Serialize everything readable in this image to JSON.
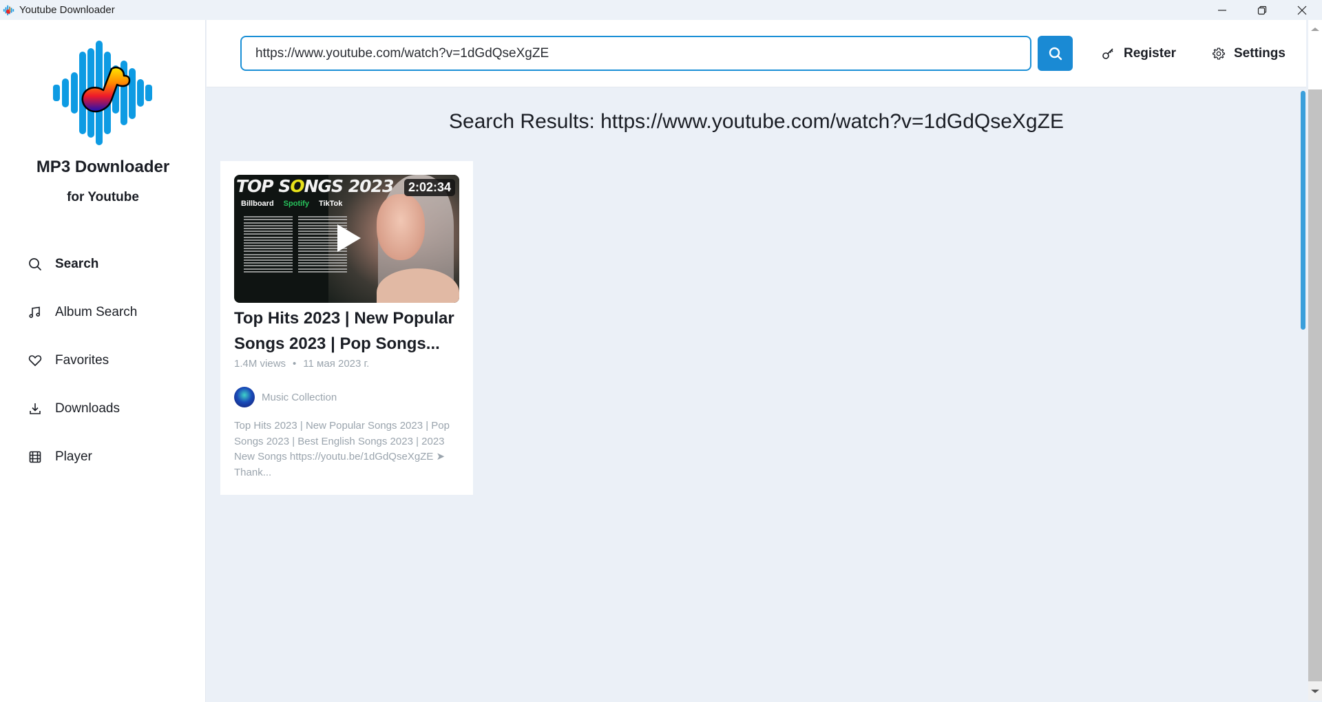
{
  "window": {
    "title": "Youtube Downloader",
    "controls": [
      "minimize",
      "restore",
      "close"
    ]
  },
  "sidebar": {
    "brand_title": "MP3 Downloader",
    "brand_subtitle": "for Youtube",
    "items": [
      {
        "label": "Search",
        "icon": "search-icon",
        "active": true
      },
      {
        "label": "Album Search",
        "icon": "music-note-icon",
        "active": false
      },
      {
        "label": "Favorites",
        "icon": "heart-icon",
        "active": false
      },
      {
        "label": "Downloads",
        "icon": "download-icon",
        "active": false
      },
      {
        "label": "Player",
        "icon": "film-icon",
        "active": false
      }
    ]
  },
  "header": {
    "search_value": "https://www.youtube.com/watch?v=1dGdQseXgZE",
    "search_placeholder": "",
    "register_label": "Register",
    "settings_label": "Settings",
    "accent_color": "#1a8ad4"
  },
  "main": {
    "results_title": "Search Results: https://www.youtube.com/watch?v=1dGdQseXgZE",
    "results": [
      {
        "thumbnail": {
          "headline_pre": "TOP S",
          "headline_o": "O",
          "headline_post": "NGS 2023",
          "brands": [
            "Billboard",
            "Spotify",
            "TikTok"
          ],
          "duration": "2:02:34"
        },
        "title": "Top Hits 2023 | New Popular Songs 2023 | Pop Songs...",
        "views": "1.4M views",
        "separator": "•",
        "date": "11 мая 2023 г.",
        "channel": "Music Collection",
        "description": "Top Hits 2023 | New Popular Songs 2023 | Pop Songs 2023 | Best English Songs 2023 | 2023 New Songs https://youtu.be/1dGdQseXgZE ➤ Thank..."
      }
    ]
  }
}
